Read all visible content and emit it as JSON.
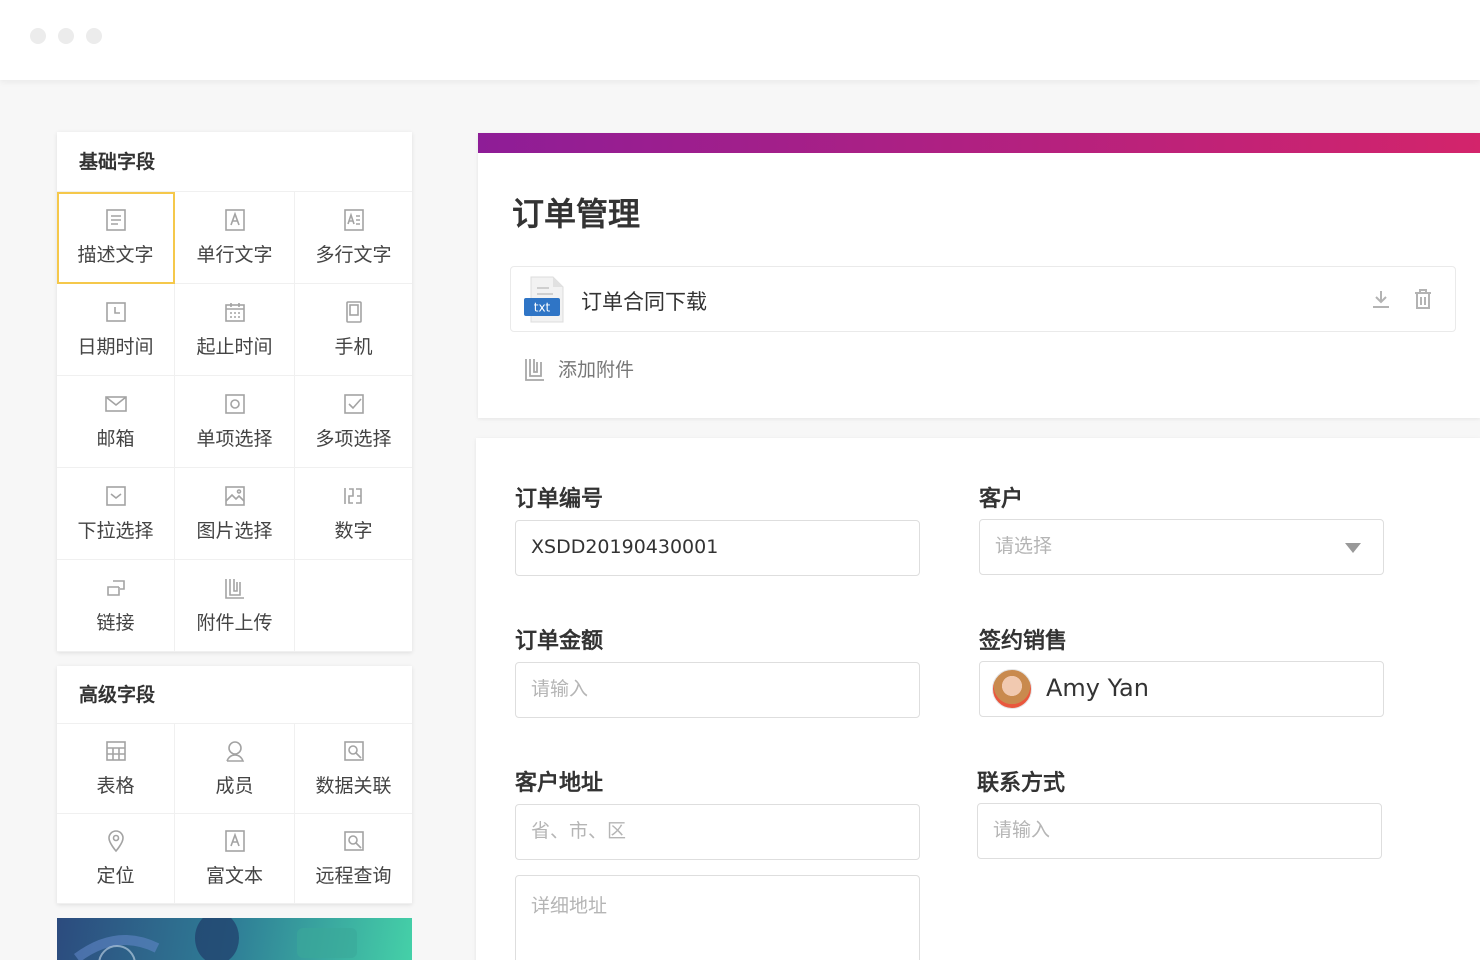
{
  "window": {
    "dots": [
      "close-dot",
      "minimize-dot",
      "maximize-dot"
    ]
  },
  "palette": {
    "basic": {
      "title": "基础字段",
      "items": [
        {
          "label": "描述文字",
          "icon": "description-icon"
        },
        {
          "label": "单行文字",
          "icon": "single-line-text-icon"
        },
        {
          "label": "多行文字",
          "icon": "multi-line-text-icon"
        },
        {
          "label": "日期时间",
          "icon": "datetime-icon"
        },
        {
          "label": "起止时间",
          "icon": "date-range-icon"
        },
        {
          "label": "手机",
          "icon": "mobile-icon"
        },
        {
          "label": "邮箱",
          "icon": "email-icon"
        },
        {
          "label": "单项选择",
          "icon": "radio-icon"
        },
        {
          "label": "多项选择",
          "icon": "checkbox-icon"
        },
        {
          "label": "下拉选择",
          "icon": "dropdown-icon"
        },
        {
          "label": "图片选择",
          "icon": "image-icon"
        },
        {
          "label": "数字",
          "icon": "number-icon"
        },
        {
          "label": "链接",
          "icon": "link-icon"
        },
        {
          "label": "附件上传",
          "icon": "attachment-icon"
        }
      ]
    },
    "advanced": {
      "title": "高级字段",
      "items": [
        {
          "label": "表格",
          "icon": "table-icon"
        },
        {
          "label": "成员",
          "icon": "member-icon"
        },
        {
          "label": "数据关联",
          "icon": "data-link-icon"
        },
        {
          "label": "定位",
          "icon": "location-icon"
        },
        {
          "label": "富文本",
          "icon": "rich-text-icon"
        },
        {
          "label": "远程查询",
          "icon": "remote-query-icon"
        }
      ]
    }
  },
  "form": {
    "title": "订单管理",
    "attachment": {
      "file_type": "txt",
      "name": "订单合同下载"
    },
    "add_attachment": "添加附件",
    "fields": {
      "order_no": {
        "label": "订单编号",
        "value": "XSDD20190430001"
      },
      "customer": {
        "label": "客户",
        "placeholder": "请选择"
      },
      "amount": {
        "label": "订单金额",
        "placeholder": "请输入"
      },
      "sales": {
        "label": "签约销售",
        "value": "Amy Yan"
      },
      "address": {
        "label": "客户地址",
        "region_placeholder": "省、市、区",
        "detail_placeholder": "详细地址"
      },
      "contact": {
        "label": "联系方式",
        "placeholder": "请输入"
      }
    }
  },
  "colors": {
    "accent_gradient_start": "#8e1d97",
    "accent_gradient_end": "#d3246b",
    "selected_outline": "#f5c84b"
  }
}
